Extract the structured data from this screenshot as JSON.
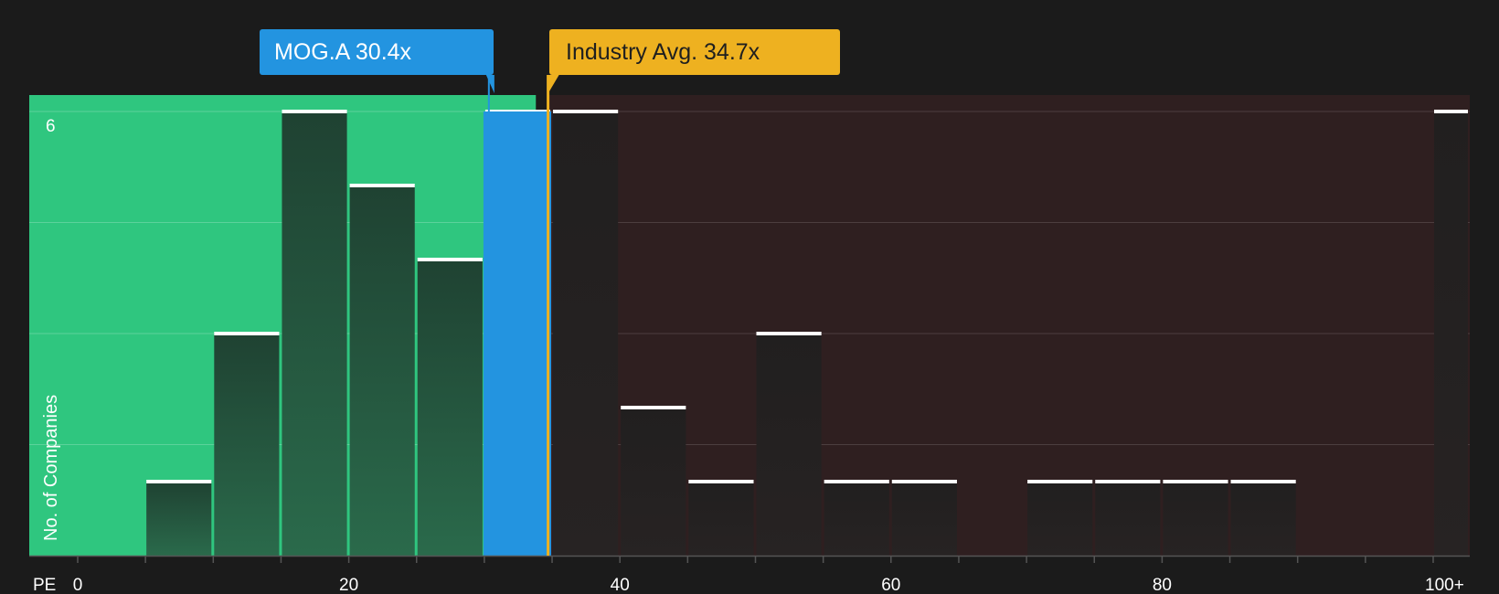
{
  "chart_data": {
    "type": "bar",
    "xlabel": "PE",
    "ylabel": "No. of Companies",
    "bin_width": 5,
    "xlim": [
      0,
      105
    ],
    "ylim": [
      0,
      6
    ],
    "x_ticks": [
      {
        "value": 0,
        "label": "0"
      },
      {
        "value": 20,
        "label": "20"
      },
      {
        "value": 40,
        "label": "40"
      },
      {
        "value": 60,
        "label": "60"
      },
      {
        "value": 80,
        "label": "80"
      },
      {
        "value": 100,
        "label": "100+"
      }
    ],
    "y_tick_labels": [
      {
        "value": 6,
        "label": "6"
      }
    ],
    "bins": [
      {
        "x_start": 5,
        "value": 1
      },
      {
        "x_start": 10,
        "value": 3
      },
      {
        "x_start": 15,
        "value": 6
      },
      {
        "x_start": 20,
        "value": 5
      },
      {
        "x_start": 25,
        "value": 4
      },
      {
        "x_start": 30,
        "value": 6
      },
      {
        "x_start": 35,
        "value": 6
      },
      {
        "x_start": 40,
        "value": 2
      },
      {
        "x_start": 45,
        "value": 1
      },
      {
        "x_start": 50,
        "value": 3
      },
      {
        "x_start": 55,
        "value": 1
      },
      {
        "x_start": 60,
        "value": 1
      },
      {
        "x_start": 70,
        "value": 1
      },
      {
        "x_start": 75,
        "value": 1
      },
      {
        "x_start": 80,
        "value": 1
      },
      {
        "x_start": 85,
        "value": 1
      },
      {
        "x_start": 100,
        "value": 6
      }
    ],
    "company": {
      "ticker": "MOG.A",
      "pe": 30.4,
      "label": "MOG.A 30.4x",
      "highlight_bin_start": 30
    },
    "industry": {
      "pe": 34.7,
      "label": "Industry Avg. 34.7x"
    },
    "regions": {
      "undervalued_end": 33.8,
      "overvalued_start": 34.7
    },
    "colors": {
      "background": "#1b1b1b",
      "green_region": "#2fc67f",
      "red_region": "#2f1f20",
      "bar_in_green": "#244a38",
      "bar_in_red": "#242121",
      "company_bar": "#2394e0",
      "industry_line": "#eeb120",
      "bar_cap": "#ffffff",
      "text": "#ffffff"
    }
  }
}
